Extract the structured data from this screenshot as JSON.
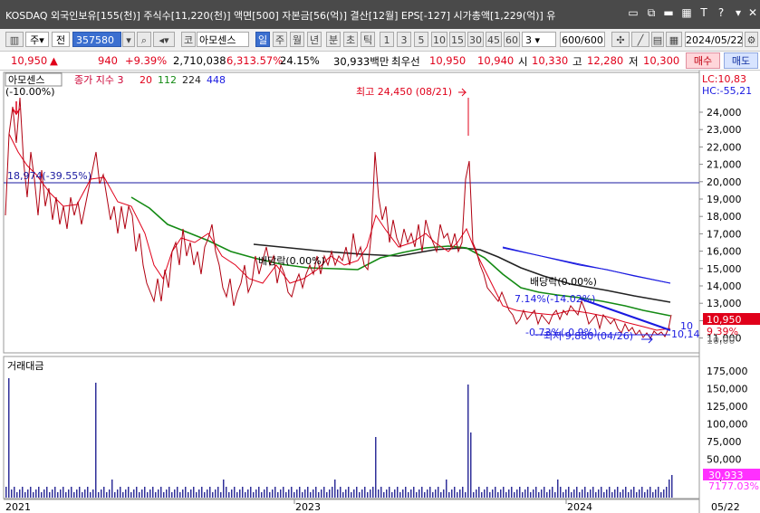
{
  "titlebar": {
    "text": "KOSDAQ 외국인보유[155(천)] 주식수[11,220(천)] 액면[500] 자본금[56(억)] 결산[12월] EPS[-127] 시가총액[1,229(억)] 유",
    "icons": [
      "chat-icon",
      "restore-icon",
      "minimize-icon",
      "calc-icon",
      "font-T-icon",
      "help-icon",
      "close-icon"
    ]
  },
  "toolbar": {
    "type_select": "주",
    "market_btn": "전",
    "code": "357580",
    "stock_prefix": "코",
    "stock_name": "아모센스",
    "periods": [
      "일",
      "주",
      "월",
      "년",
      "분",
      "초",
      "틱"
    ],
    "selected_period": "일",
    "intervals": [
      "1",
      "3",
      "5",
      "10",
      "15",
      "30",
      "45",
      "60"
    ],
    "interval_select": "3",
    "count": "600/600",
    "date": "2024/05/22"
  },
  "inforow": {
    "price": "10,950",
    "change": "940",
    "change_pct": "+9.39%",
    "volume": "2,710,038",
    "vol_ratio": "6,313.57%",
    "turnover": "24.15%",
    "amount": "30,933백만",
    "best_ask_label": "최우선",
    "best_ask": "10,950",
    "best_bid": "10,940",
    "open_label": "시",
    "open": "10,330",
    "high_label": "고",
    "high": "12,280",
    "low_label": "저",
    "low": "10,300",
    "buy_label": "매수",
    "sell_label": "매도"
  },
  "legend": {
    "name": "아모센스",
    "type_label": "종가 지수 3",
    "ma20": "20",
    "ma112": "112",
    "ma224": "224",
    "ma448": "448",
    "pct_label": "(-10.00%)"
  },
  "colors": {
    "price": "#e0001a",
    "ma20": "#e0001a",
    "ma112": "#148a14",
    "ma224": "#222222",
    "ma448": "#1a1ae0",
    "volume": "#30309a",
    "hline": "#1a1aa0"
  },
  "annotations": {
    "high_label": "최고 24,450 (08/21)",
    "low_label": "최저 9,880 (04/26)",
    "hline_label": "18,974(-39.55%)",
    "line1_label": "배당락(0.00%)",
    "line2_label": "배당락(0.00%)",
    "trend_label": "7.14%(-14.02%)",
    "bottom_label": "-0.73%(-0.9%)",
    "right_small": "10,14",
    "right_ten": "10"
  },
  "right_info": {
    "lc": "LC:10,83",
    "hc": "HC:-55,21"
  },
  "price_axis": {
    "ticks": [
      "24,000",
      "23,000",
      "22,000",
      "21,000",
      "20,000",
      "19,000",
      "18,000",
      "17,000",
      "16,000",
      "15,000",
      "14,000",
      "13,000",
      "12,000",
      "11,000"
    ],
    "current_price_tag": "10,950",
    "current_pct_tag": "9.39%",
    "low_tag": "10,00"
  },
  "volume_panel": {
    "title": "거래대금",
    "ticks": [
      "175,000",
      "150,000",
      "125,000",
      "100,000",
      "75,000",
      "50,000",
      "25,000"
    ],
    "current_tag": "30,933",
    "pct_tag": "7177.03%"
  },
  "x_axis": {
    "ticks": [
      "2021",
      "2023",
      "2024"
    ],
    "end_label": "05/22"
  }
}
